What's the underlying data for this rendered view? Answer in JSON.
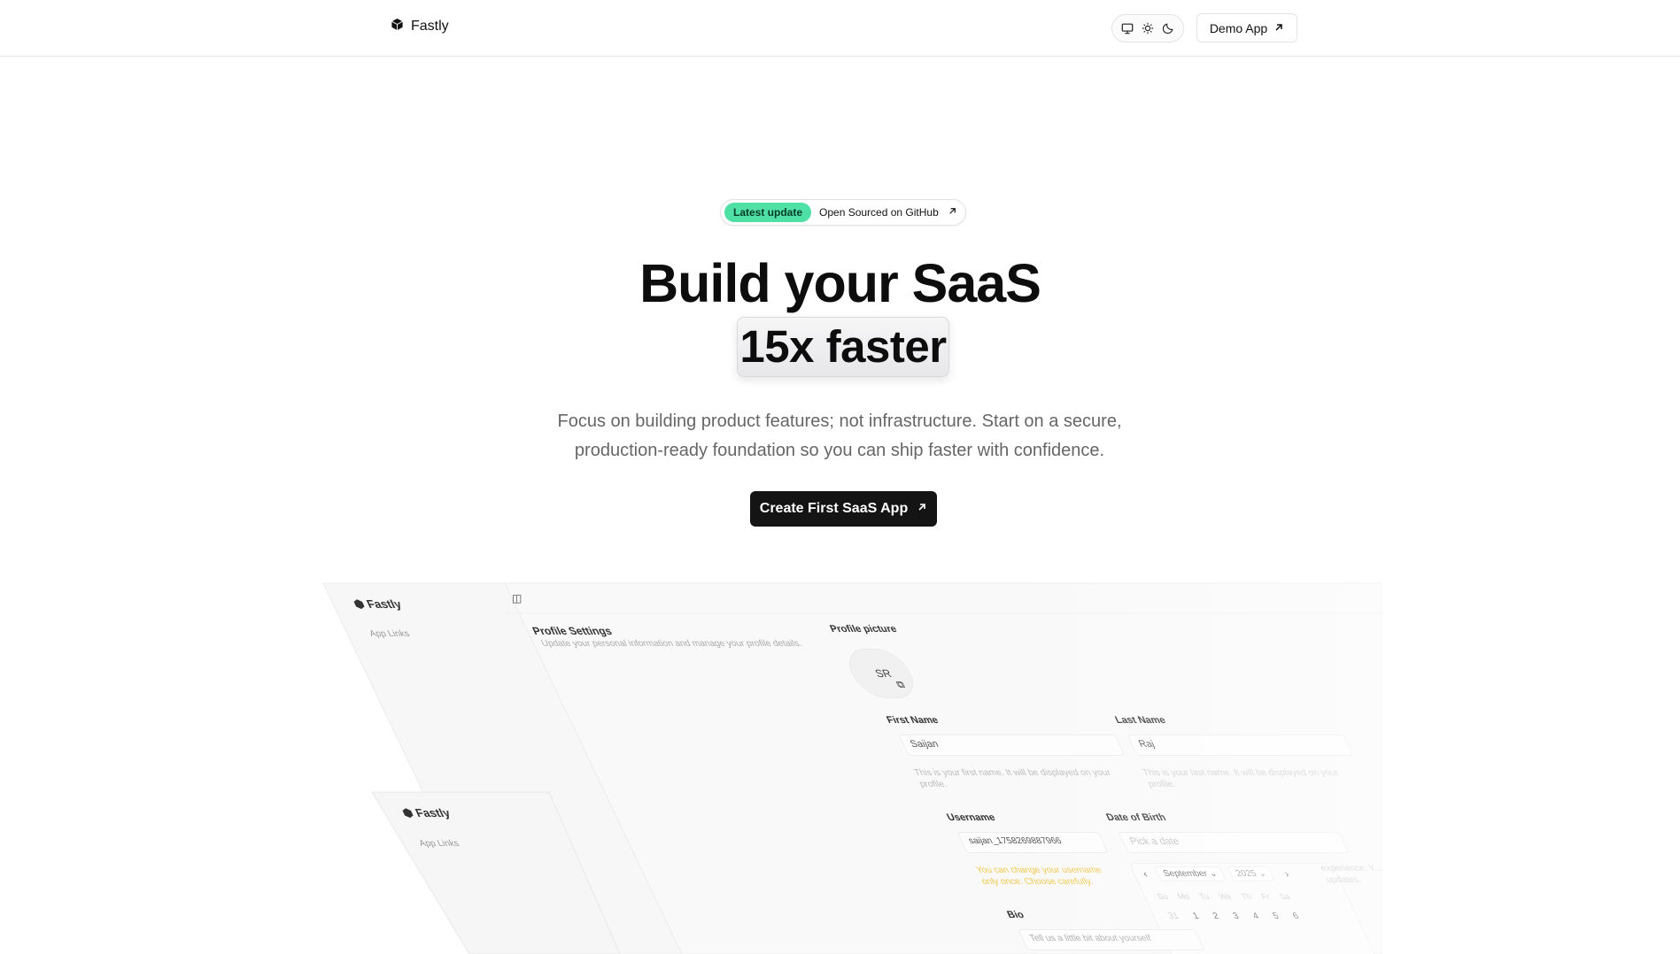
{
  "header": {
    "brand": "Fastly",
    "theme_options": [
      "monitor-icon",
      "sun-icon",
      "moon-icon"
    ],
    "demo_label": "Demo App"
  },
  "hero": {
    "badge_tag": "Latest update",
    "badge_text": "Open Sourced on GitHub",
    "title_line1": "Build your SaaS",
    "title_line2": "15x faster",
    "subtitle_line1": "Focus on building product features; not infrastructure. Start on a secure,",
    "subtitle_line2": "production-ready foundation so you can ship faster with confidence.",
    "cta_label": "Create First SaaS App",
    "badge_color": "#4fe0a6",
    "cta_color": "#141414"
  },
  "preview": {
    "brand": "Fastly",
    "app_links": "App Links",
    "section_title": "Profile Settings",
    "section_desc": "Update your personal information and manage your profile details.",
    "profile_picture_label": "Profile picture",
    "avatar_initials": "SR",
    "first_name_label": "First Name",
    "first_name_value": "Saijan",
    "first_name_help": "This is your first name. It will be displayed on your profile.",
    "last_name_label": "Last Name",
    "last_name_value": "Raj",
    "last_name_help": "This is your last name. It will be displayed on your profile.",
    "username_label": "Username",
    "username_value": "saijan_1758269887966",
    "username_warning": "You can change your username only once. Choose carefully.",
    "dob_label": "Date of Birth",
    "dob_placeholder": "Pick a date",
    "month": "September",
    "year": "2025",
    "weekdays": [
      "Su",
      "Mo",
      "Tu",
      "We",
      "Th",
      "Fr",
      "Sa"
    ],
    "days_row1": [
      "31",
      "1",
      "2",
      "3",
      "4",
      "5",
      "6"
    ],
    "bio_label": "Bio",
    "bio_placeholder": "Tell us a little bit about yourself",
    "right_snippet": "experience. Y... updates."
  }
}
